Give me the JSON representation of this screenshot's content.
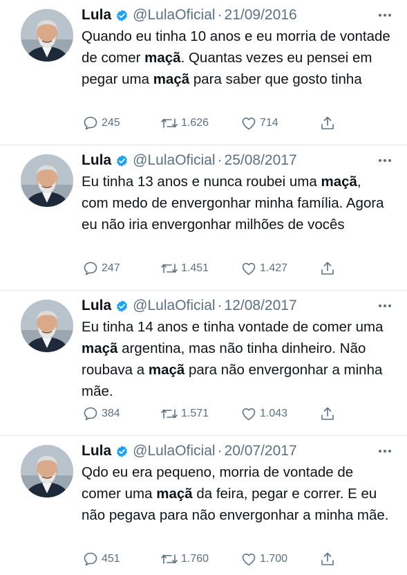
{
  "colors": {
    "text": "#0f1419",
    "secondary": "#5b7083",
    "verified": "#1da1f2",
    "divider": "#e1e6ea"
  },
  "tweets": [
    {
      "name": "Lula",
      "handle": "@LulaOficial",
      "separator": "·",
      "date": "21/09/2016",
      "text_parts": [
        "Quando eu tinha 10 anos e eu morria de vontade de comer ",
        "maçã",
        ". Quantas vezes eu pensei em pegar uma ",
        "maçã",
        " para saber que gosto tinha"
      ],
      "replies": "245",
      "retweets": "1.626",
      "likes": "714"
    },
    {
      "name": "Lula",
      "handle": "@LulaOficial",
      "separator": "·",
      "date": "25/08/2017",
      "text_parts": [
        "Eu tinha 13 anos e nunca roubei uma ",
        "maçã",
        ", com medo de envergonhar minha família. Agora eu não iria envergonhar milhões de vocês"
      ],
      "replies": "247",
      "retweets": "1.451",
      "likes": "1.427"
    },
    {
      "name": "Lula",
      "handle": "@LulaOficial",
      "separator": "·",
      "date": "12/08/2017",
      "text_parts": [
        "Eu tinha 14 anos e tinha vontade de comer uma ",
        "maçã",
        " argentina, mas não tinha dinheiro. Não roubava a ",
        "maçã",
        " para não envergonhar a minha mãe."
      ],
      "replies": "384",
      "retweets": "1.571",
      "likes": "1.043"
    },
    {
      "name": "Lula",
      "handle": "@LulaOficial",
      "separator": "·",
      "date": "20/07/2017",
      "text_parts": [
        "Qdo eu era pequeno, morria de vontade de comer uma ",
        "maçã",
        " da feira, pegar e correr. E eu não pegava para não envergonhar a minha mãe."
      ],
      "replies": "451",
      "retweets": "1.760",
      "likes": "1.700"
    }
  ]
}
